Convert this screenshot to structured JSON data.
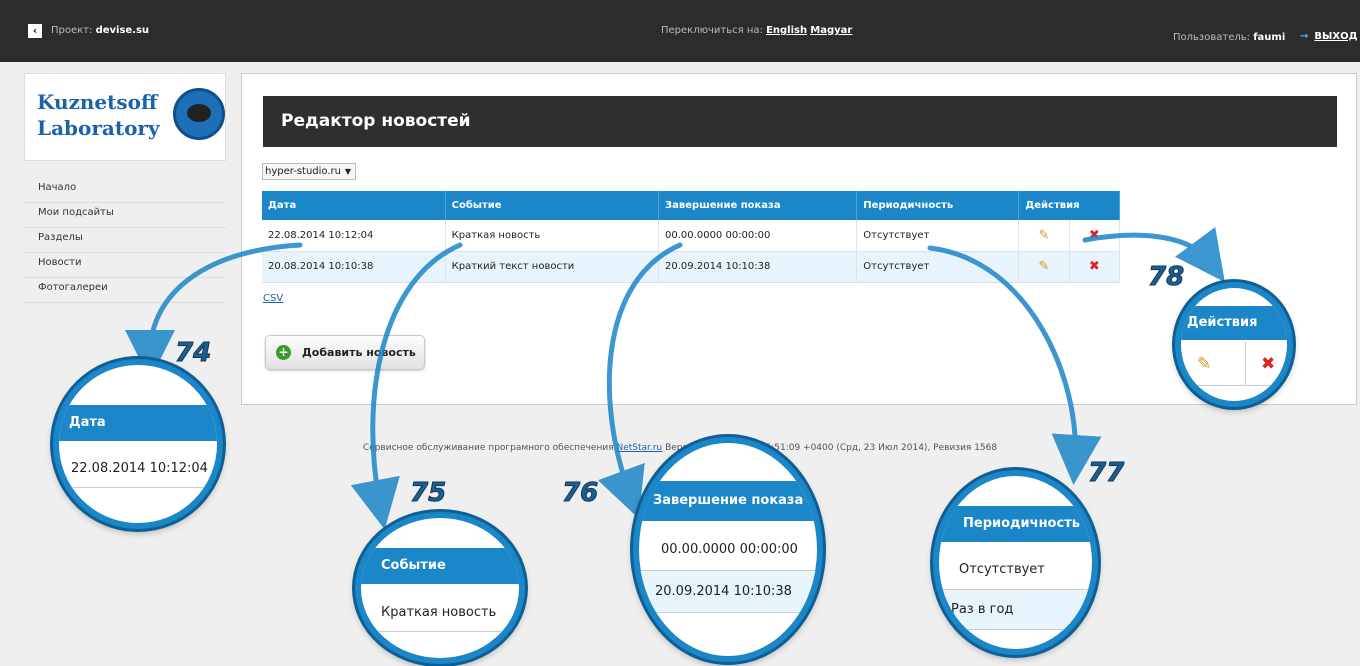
{
  "topbar": {
    "project_label": "Проект:",
    "project_name": "devise.su",
    "switch_label": "Переключиться на:",
    "lang_english": "English",
    "lang_magyar": "Magyar",
    "user_label": "Пользователь:",
    "user_name": "faumi",
    "logout": "ВЫХОД"
  },
  "logo": {
    "line1": "Kuznetsoff",
    "line2": "Laboratory"
  },
  "sidebar": {
    "items": [
      {
        "label": "Начало"
      },
      {
        "label": "Мои подсайты"
      },
      {
        "label": "Разделы"
      },
      {
        "label": "Новости"
      },
      {
        "label": "Фотогалереи"
      }
    ]
  },
  "main": {
    "title": "Редактор новостей",
    "site_select": "hyper-studio.ru",
    "table": {
      "headers": [
        "Дата",
        "Событие",
        "Завершение показа",
        "Периодичность",
        "Действия"
      ],
      "rows": [
        [
          "22.08.2014 10:12:04",
          "Краткая новость",
          "00.00.0000 00:00:00",
          "Отсутствует"
        ],
        [
          "20.08.2014 10:10:38",
          "Краткий текст новости",
          "20.09.2014 10:10:38",
          "Отсутствует"
        ]
      ]
    },
    "csv": "CSV",
    "add_button": "Добавить новость"
  },
  "footer": {
    "text_before": "Сервисное обслуживание програмного обеспечения",
    "link": "NetStar.ru",
    "text_after": "Версия: 2014-07-23 15:51:09 +0400 (Срд, 23 Июл 2014), Ревизия 1568"
  },
  "callouts": {
    "n74": "74",
    "n75": "75",
    "n76": "76",
    "n77": "77",
    "n78": "78",
    "c74": {
      "header": "Дата",
      "row1": "22.08.2014 10:12:04"
    },
    "c75": {
      "header": "Событие",
      "row1": "Краткая новость"
    },
    "c76": {
      "header": "Завершение показа",
      "row1": "00.00.0000 00:00:00",
      "row2": "20.09.2014 10:10:38"
    },
    "c77": {
      "header": "Периодичность",
      "row1": "Отсутствует",
      "row2": "Раз в год"
    },
    "c78": {
      "header": "Действия"
    }
  },
  "colors": {
    "accent": "#1b86c8",
    "topbar": "#2c2c2c",
    "delete": "#dd2222",
    "add": "#3a9a2e"
  }
}
